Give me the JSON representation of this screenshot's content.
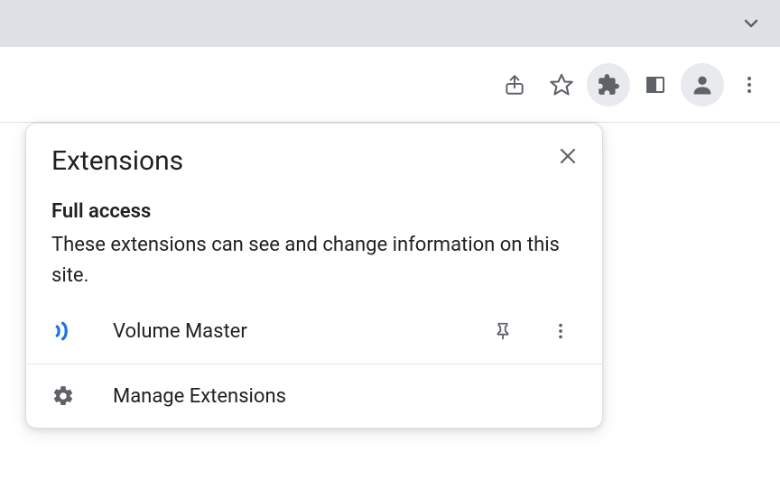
{
  "popup": {
    "title": "Extensions",
    "section_heading": "Full access",
    "section_desc": "These extensions can see and change information on this site.",
    "extension": {
      "name": "Volume Master"
    },
    "manage_label": "Manage Extensions"
  }
}
